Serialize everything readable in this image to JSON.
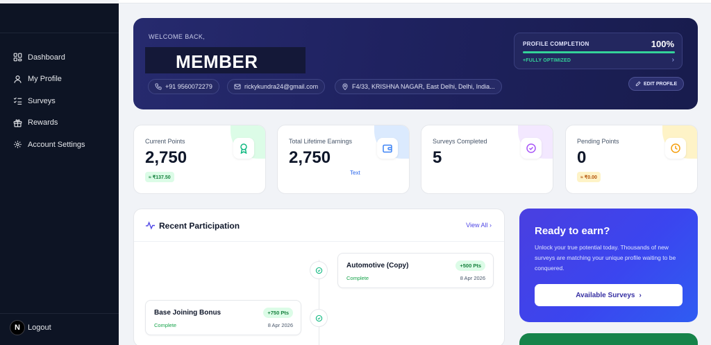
{
  "sidebar": {
    "items": [
      {
        "label": "Dashboard",
        "icon": "grid-icon"
      },
      {
        "label": "My Profile",
        "icon": "user-icon"
      },
      {
        "label": "Surveys",
        "icon": "list-check-icon"
      },
      {
        "label": "Rewards",
        "icon": "gift-icon"
      },
      {
        "label": "Account Settings",
        "icon": "gear-icon"
      }
    ],
    "avatar_letter": "N",
    "logout_label": "Logout"
  },
  "hero": {
    "welcome": "WELCOME BACK,",
    "name": "MEMBER",
    "phone": "+91 9560072279",
    "email": "rickykundra24@gmail.com",
    "address": "F4/33, KRISHNA NAGAR, East Delhi, Delhi, India...",
    "profile_completion_label": "PROFILE COMPLETION",
    "profile_completion_value": "100%",
    "profile_completion_fraction": 1.0,
    "profile_status": "+FULLY OPTIMIZED",
    "edit_profile_label": "EDIT PROFILE"
  },
  "stats": [
    {
      "label": "Current Points",
      "value": "2,750",
      "badge": "≈ ₹137.50",
      "accent": "#10b981"
    },
    {
      "label": "Total Lifetime Earnings",
      "value": "2,750",
      "sub": "Text",
      "accent": "#3b82f6"
    },
    {
      "label": "Surveys Completed",
      "value": "5",
      "accent": "#a855f7"
    },
    {
      "label": "Pending Points",
      "value": "0",
      "badge": "≈ ₹0.00",
      "accent": "#f59e0b"
    }
  ],
  "recent": {
    "title": "Recent Participation",
    "view_all": "View All",
    "entries": [
      {
        "title": "Automotive (Copy)",
        "points": "+500 Pts",
        "status": "Complete",
        "date": "8 Apr 2026"
      },
      {
        "title": "Base Joining Bonus",
        "points": "+750 Pts",
        "status": "Complete",
        "date": "8 Apr 2026"
      }
    ]
  },
  "ready": {
    "title": "Ready to earn?",
    "text": "Unlock your true potential today. Thousands of new surveys are matching your unique profile waiting to be conquered.",
    "button_label": "Available Surveys"
  },
  "colors": {
    "sidebar_bg": "#0d1424",
    "hero_bg": "#1f2260",
    "accent_green": "#34d399",
    "ready_bg": "#3b45ef"
  }
}
